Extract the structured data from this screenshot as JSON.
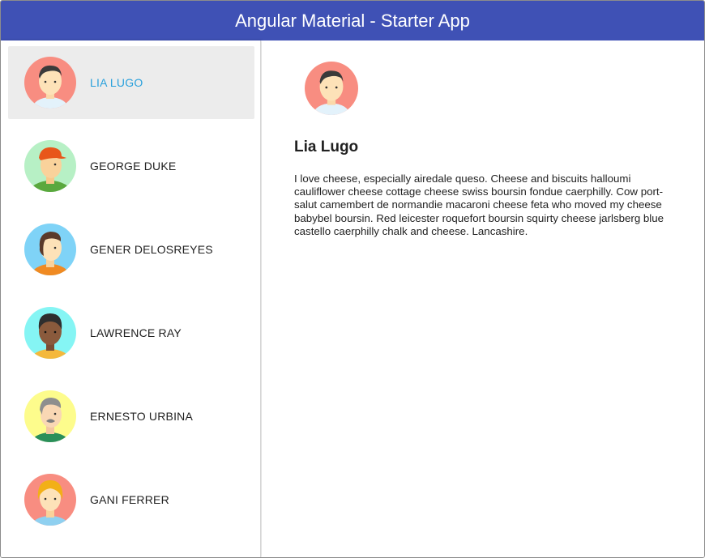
{
  "app": {
    "title": "Angular Material - Starter App",
    "toolbar_color": "#3f51b5",
    "selected_color": "#29a0dc"
  },
  "sidebar": {
    "users": [
      {
        "name": "LIA LUGO",
        "avatar": "svg-1",
        "bg": "#f88d81",
        "selected": true
      },
      {
        "name": "GEORGE DUKE",
        "avatar": "svg-2",
        "bg": "#b7f0c5",
        "selected": false
      },
      {
        "name": "GENER DELOSREYES",
        "avatar": "svg-3",
        "bg": "#7fd3f7",
        "selected": false
      },
      {
        "name": "LAWRENCE RAY",
        "avatar": "svg-4",
        "bg": "#85f5f4",
        "selected": false
      },
      {
        "name": "ERNESTO URBINA",
        "avatar": "svg-5",
        "bg": "#fdfc8c",
        "selected": false
      },
      {
        "name": "GANI FERRER",
        "avatar": "svg-6",
        "bg": "#f88d81",
        "selected": false
      }
    ]
  },
  "detail": {
    "name": "Lia Lugo",
    "content": "I love cheese, especially airedale queso. Cheese and biscuits halloumi cauliflower cheese cottage cheese swiss boursin fondue caerphilly. Cow port-salut camembert de normandie macaroni cheese feta who moved my cheese babybel boursin. Red leicester roquefort boursin squirty cheese jarlsberg blue castello caerphilly chalk and cheese. Lancashire."
  }
}
